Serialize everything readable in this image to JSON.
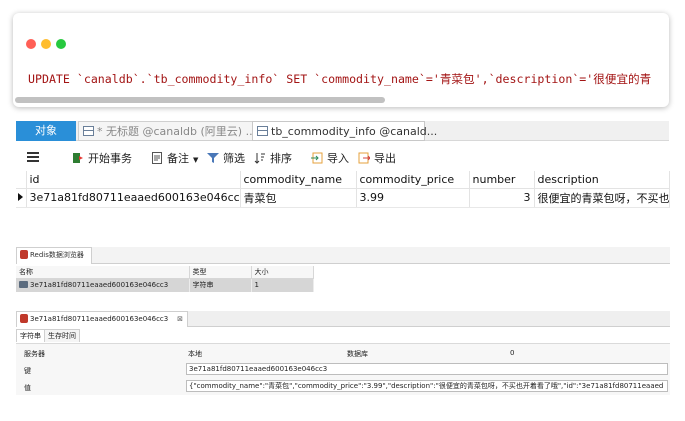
{
  "code": {
    "sql": "UPDATE `canaldb`.`tb_commodity_info` SET `commodity_name`='青菜包',`description`='很便宜的青"
  },
  "navicat": {
    "tabs": {
      "objects": "对象",
      "untitled": "* 无标题 @canaldb (阿里云) ...",
      "table": "tb_commodity_info @canald..."
    },
    "toolbar": {
      "begin_transaction": "开始事务",
      "memo": "备注",
      "filter": "筛选",
      "sort": "排序",
      "import": "导入",
      "export": "导出"
    },
    "grid": {
      "columns": [
        "id",
        "commodity_name",
        "commodity_price",
        "number",
        "description"
      ],
      "rows": [
        [
          "3e71a81fd80711eaaed600163e046cc3",
          "青菜包",
          "3.99",
          "3",
          "很便宜的青菜包呀，不买也开"
        ]
      ]
    }
  },
  "redis": {
    "title": "Redis数据浏览器",
    "list": {
      "columns": [
        "名称",
        "类型",
        "大小"
      ],
      "rows": [
        [
          "3e71a81fd80711eaaed600163e046cc3",
          "字符串",
          "1"
        ]
      ]
    },
    "detail": {
      "tab_label": "3e71a81fd80711eaaed600163e046cc3",
      "close": "⊠",
      "subtabs": [
        "字符串",
        "生存时间"
      ],
      "server_label": "服务器",
      "server_value": "本地",
      "db_label": "数据库",
      "db_value": "0",
      "key_label": "键",
      "key_value": "3e71a81fd80711eaaed600163e046cc3",
      "value_label": "值",
      "value_value": "{\"commodity_name\":\"青菜包\",\"commodity_price\":\"3.99\",\"description\":\"很便宜的青菜包呀，不买也开着看了哦\",\"id\":\"3e71a81fd80711eaaed"
    }
  }
}
